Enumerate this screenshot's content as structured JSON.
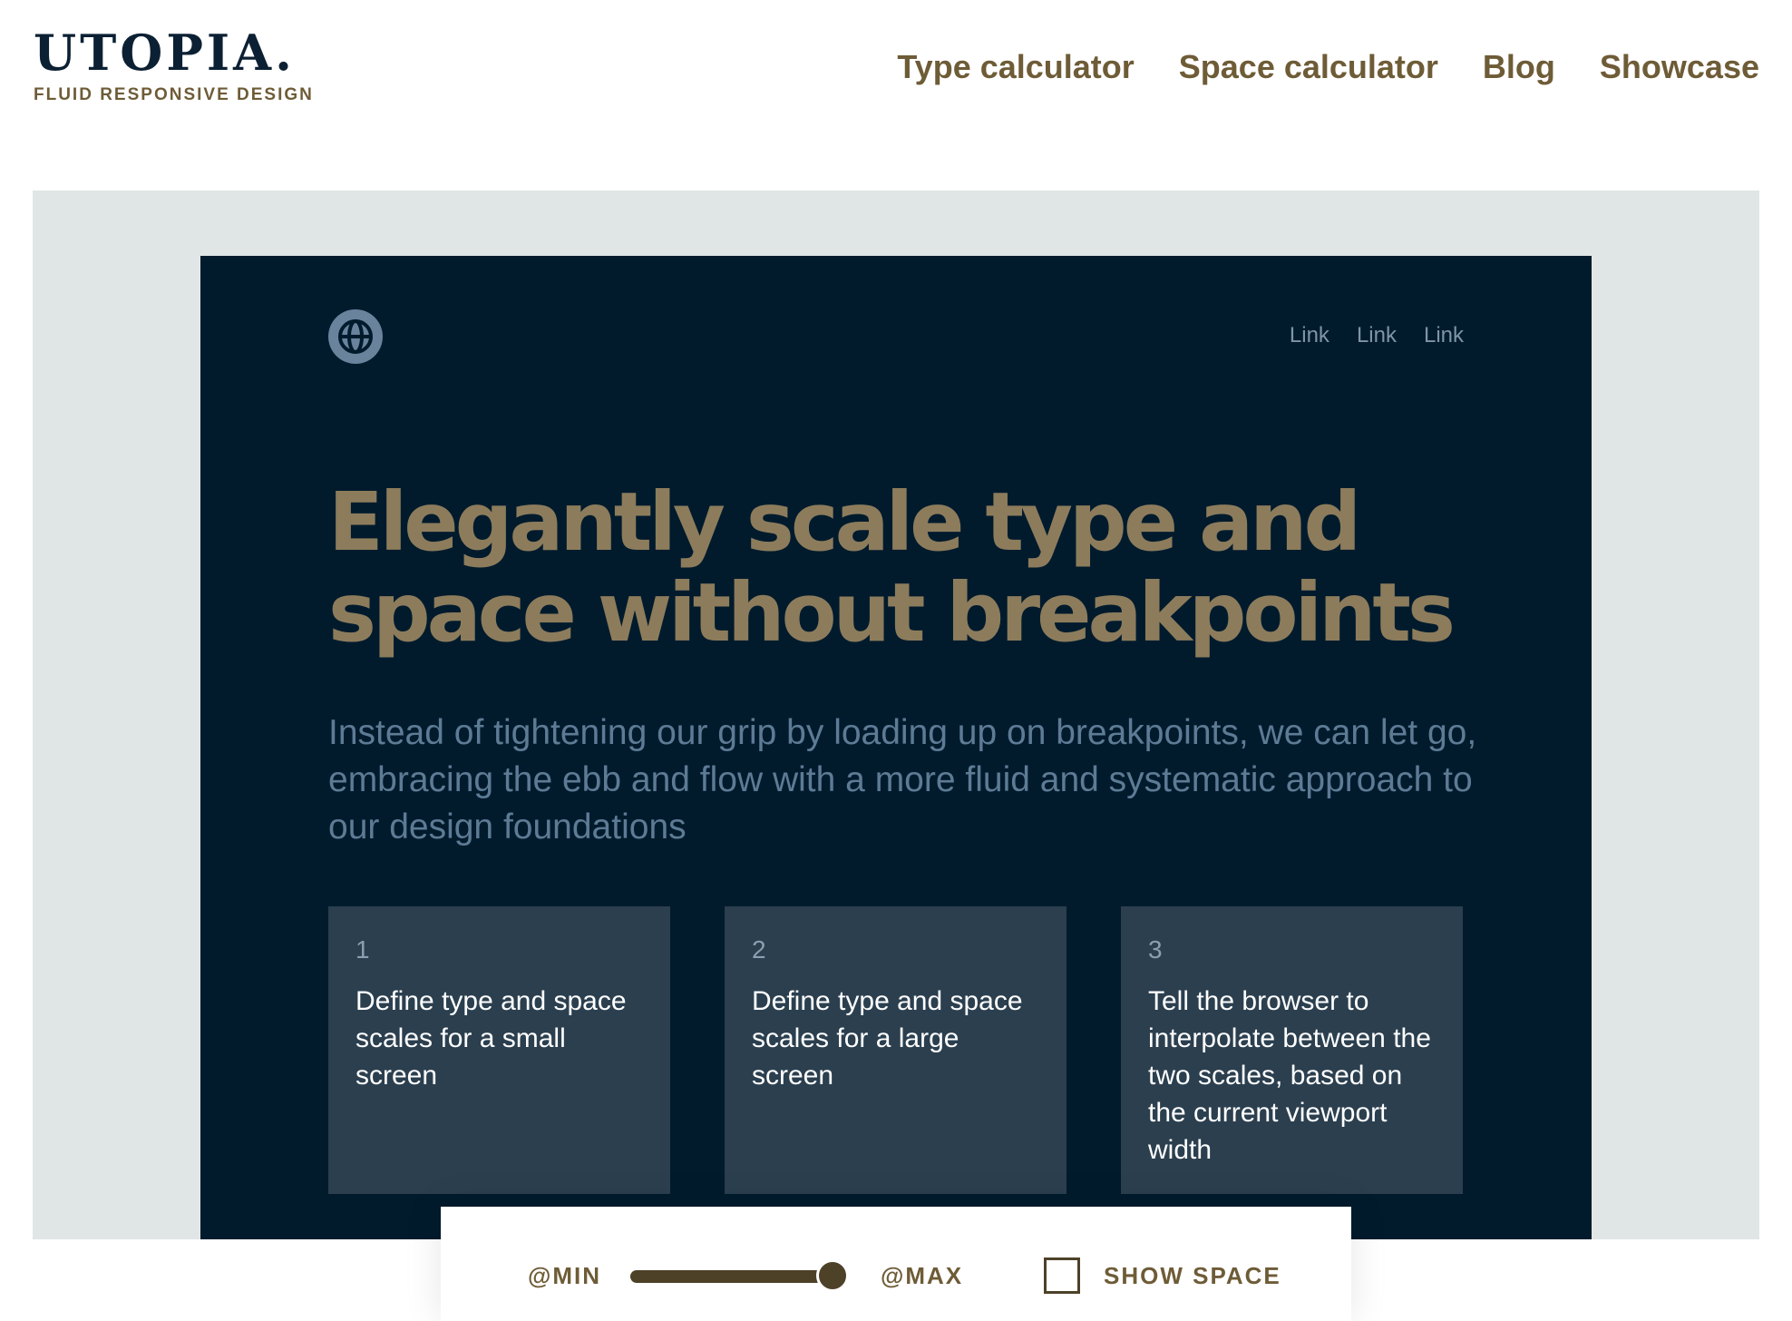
{
  "header": {
    "brand": {
      "title": "UTOPIA.",
      "subtitle": "FLUID RESPONSIVE DESIGN"
    },
    "nav": [
      {
        "label": "Type calculator"
      },
      {
        "label": "Space calculator"
      },
      {
        "label": "Blog"
      },
      {
        "label": "Showcase"
      }
    ]
  },
  "hero": {
    "logo_icon": "globe-icon",
    "links": [
      {
        "label": "Link"
      },
      {
        "label": "Link"
      },
      {
        "label": "Link"
      }
    ],
    "title": "Elegantly scale type and space without breakpoints",
    "intro": "Instead of tightening our grip by loading up on breakpoints, we can let go, embracing the ebb and flow with a more fluid and systematic approach to our design foundations",
    "steps": [
      {
        "number": "1",
        "text": "Define type and space scales for a small screen"
      },
      {
        "number": "2",
        "text": "Define type and space scales for a large screen"
      },
      {
        "number": "3",
        "text": "Tell the browser to interpolate between the two scales, based on the current viewport width"
      }
    ]
  },
  "controls": {
    "min_label": "@MIN",
    "max_label": "@MAX",
    "slider_value_fraction": 0.9,
    "show_space_label": "SHOW SPACE",
    "show_space_checked": false
  },
  "colors": {
    "brand_dark": "#0c2033",
    "accent_brown": "#6e5c37",
    "hero_bg": "#011b2d",
    "hero_title": "#8c7c5c",
    "card_bg": "#2b3f4f",
    "stage_bg": "#e0e6e6"
  }
}
